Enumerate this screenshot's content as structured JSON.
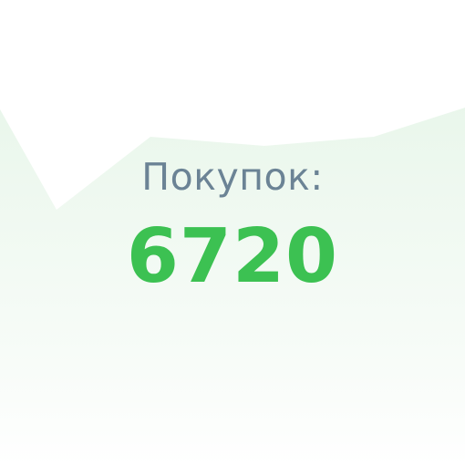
{
  "stat": {
    "label": "Покупок:",
    "value": "6720"
  },
  "colors": {
    "label": "#6b8395",
    "value": "#3cc152",
    "area_top": "#e8f6ea",
    "area_bottom": "#ffffff"
  }
}
